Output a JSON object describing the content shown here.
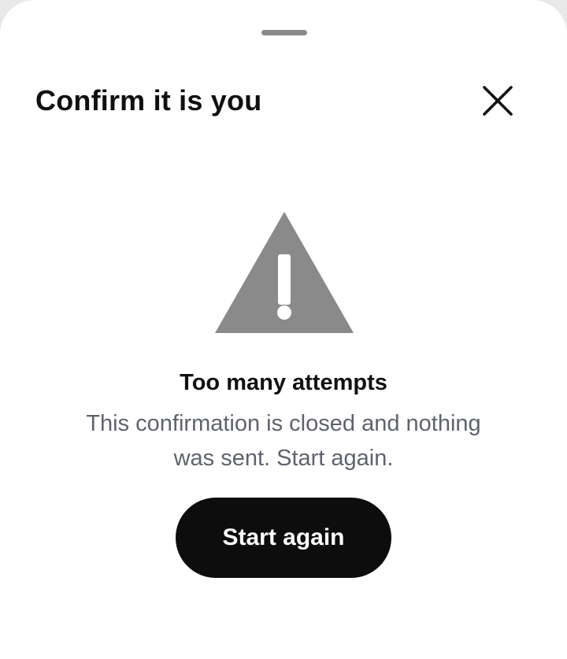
{
  "dialog": {
    "title": "Confirm it is you",
    "close_icon": "close-icon"
  },
  "status": {
    "icon": "warning-icon",
    "icon_color": "#8a8a8a",
    "title": "Too many attempts",
    "message": "This confirmation is closed and nothing was sent. Start again."
  },
  "actions": {
    "primary_label": "Start again",
    "primary_color": "#0d0d0e"
  }
}
